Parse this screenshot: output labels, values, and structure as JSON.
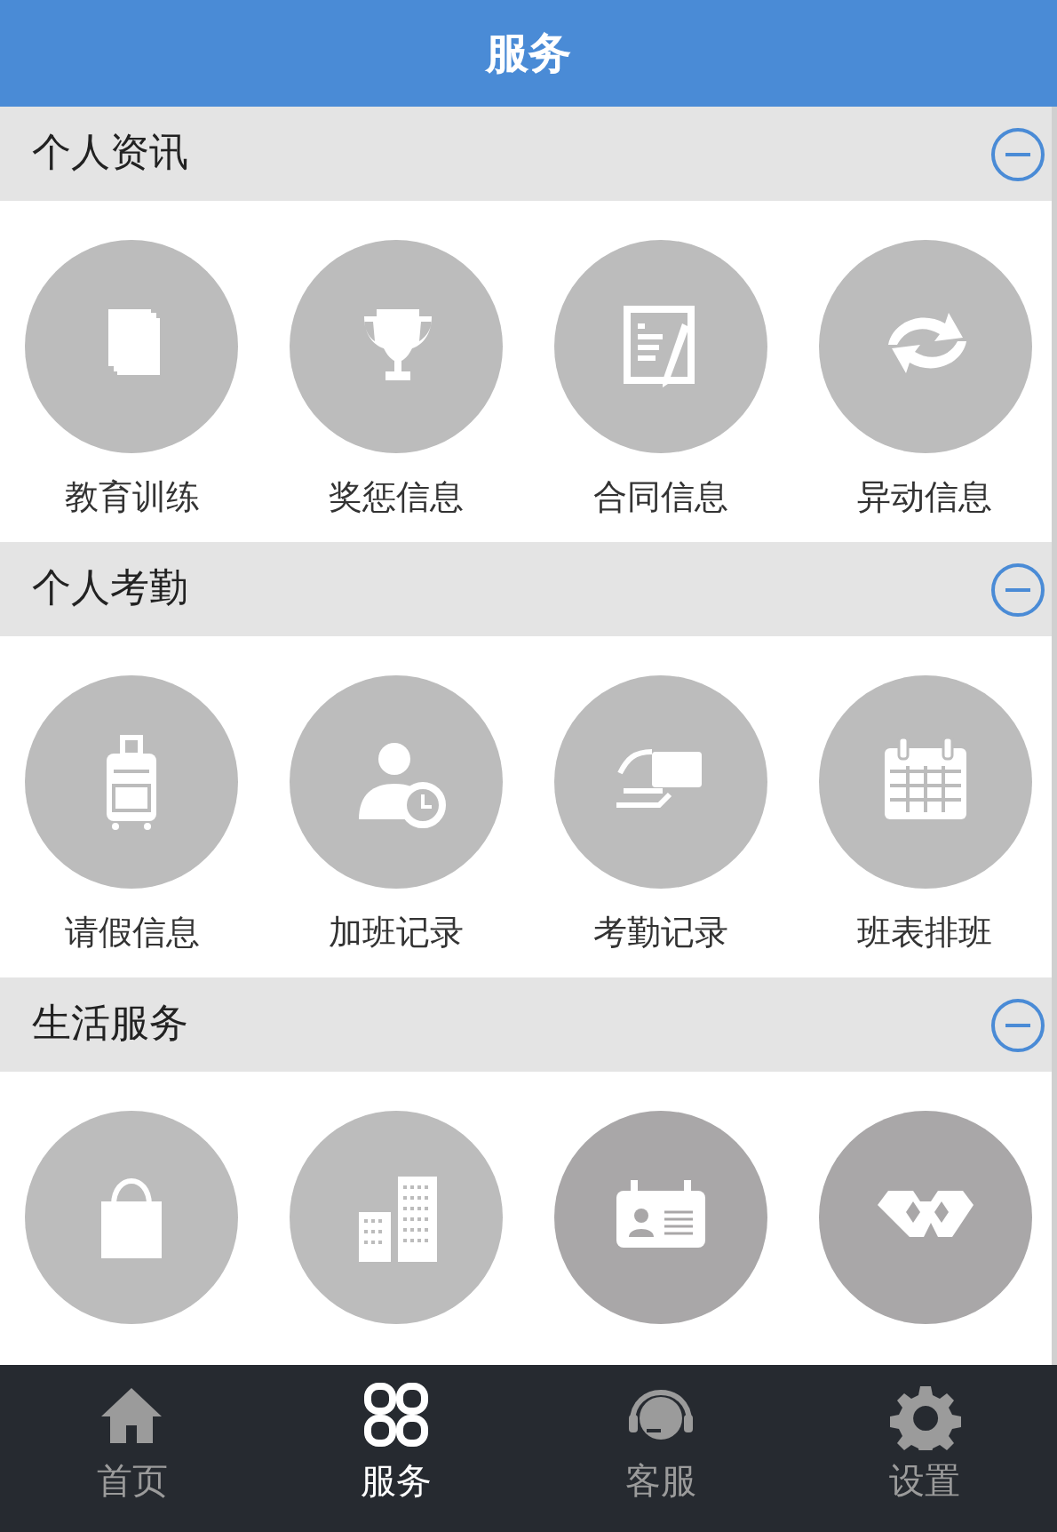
{
  "header": {
    "title": "服务"
  },
  "sections": [
    {
      "title": "个人资讯",
      "expanded": true,
      "items": [
        {
          "kind": "tile",
          "label": "教育训练"
        },
        {
          "kind": "tile",
          "label": "奖惩信息"
        },
        {
          "kind": "tile",
          "label": "合同信息"
        },
        {
          "kind": "tile",
          "label": "异动信息"
        }
      ]
    },
    {
      "title": "个人考勤",
      "expanded": true,
      "items": [
        {
          "kind": "tile",
          "label": "请假信息"
        },
        {
          "kind": "tile",
          "label": "加班记录"
        },
        {
          "kind": "tile",
          "label": "考勤记录"
        },
        {
          "kind": "tile",
          "label": "班表排班"
        }
      ]
    },
    {
      "title": "生活服务",
      "expanded": true,
      "items": [
        {
          "kind": "tile"
        },
        {
          "kind": "tile"
        },
        {
          "kind": "tile"
        },
        {
          "kind": "tile"
        }
      ]
    }
  ],
  "tabs": [
    {
      "label": "首页",
      "selected": false
    },
    {
      "label": "服务",
      "selected": true
    },
    {
      "label": "客服",
      "selected": false
    },
    {
      "label": "设置",
      "selected": false
    }
  ]
}
